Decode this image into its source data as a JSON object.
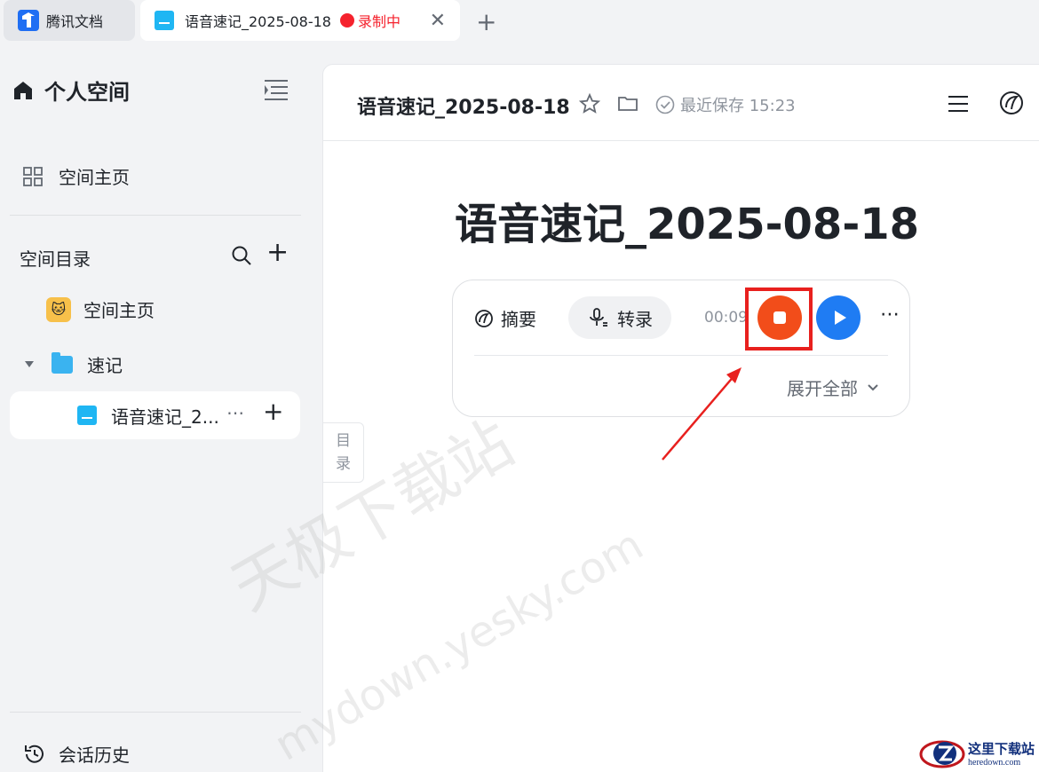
{
  "tabbar": {
    "app_tab_label": "腾讯文档",
    "doc_tab_label": "语音速记_2025-08-18",
    "recording_label": "录制中"
  },
  "sidebar": {
    "space_title": "个人空间",
    "home_label": "空间主页",
    "directory_title": "空间目录",
    "tree": {
      "home_item": "空间主页",
      "folder_item": "速记",
      "doc_item": "语音速记_2..."
    },
    "history_label": "会话历史"
  },
  "doc_header": {
    "title": "语音速记_2025-08-18",
    "saved_text": "最近保存 15:23"
  },
  "document": {
    "title": "语音速记_2025-08-18"
  },
  "recorder": {
    "summary_label": "摘要",
    "transcribe_label": "转录",
    "timer": "00:09",
    "expand_label": "展开全部"
  },
  "toc": {
    "label_line1": "目",
    "label_line2": "录"
  },
  "watermark": {
    "line1": "天极下载站",
    "line2": "mydown.yesky.com"
  },
  "corner_logo": {
    "cn": "这里下载站",
    "en": "heredown.com"
  },
  "colors": {
    "accent_blue": "#1f7cf3",
    "record_red": "#f5222d",
    "stop_orange": "#f24d1a",
    "highlight_red": "#e8201e",
    "doc_icon_blue": "#1fb6f3"
  }
}
